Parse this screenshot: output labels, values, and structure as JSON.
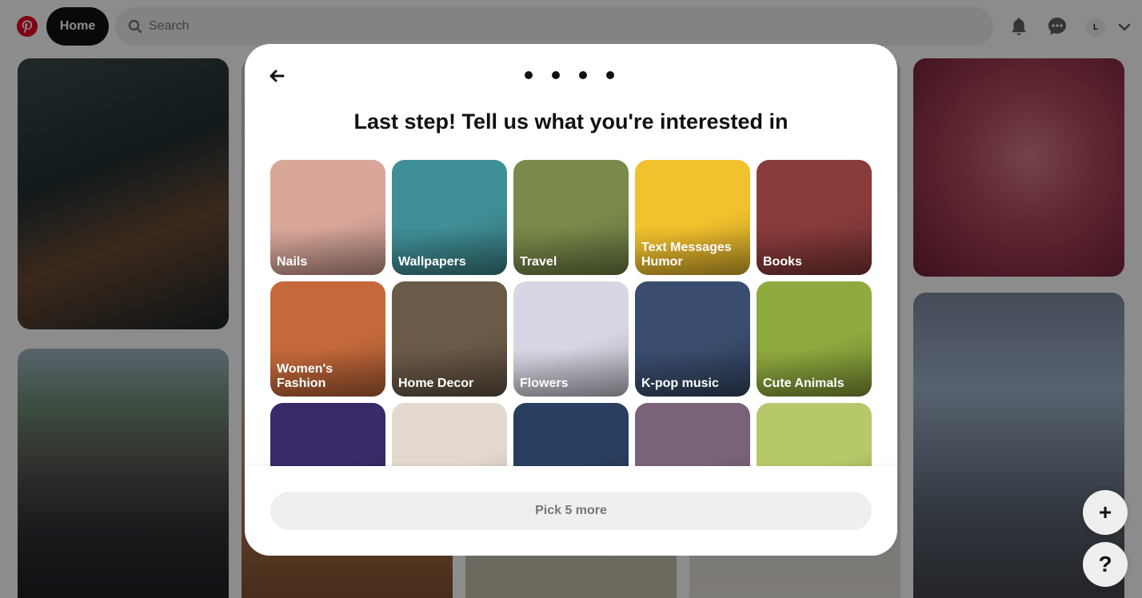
{
  "header": {
    "logo_icon": "pinterest-logo-icon",
    "home_label": "Home",
    "search_placeholder": "Search",
    "avatar_initial": "L",
    "notification_icon": "bell-icon",
    "messages_icon": "chat-icon",
    "accounts_icon": "chevron-down-icon"
  },
  "modal": {
    "back_icon": "arrow-left-icon",
    "progress_dots": 4,
    "title": "Last step! Tell us what you're interested in",
    "topics": [
      {
        "label": "Nails",
        "color": "#d9a79a"
      },
      {
        "label": "Wallpapers",
        "color": "#3f8f96"
      },
      {
        "label": "Travel",
        "color": "#7a8a4a"
      },
      {
        "label": "Text Messages Humor",
        "color": "#f2c12e"
      },
      {
        "label": "Books",
        "color": "#8a3b3b"
      },
      {
        "label": "Women's Fashion",
        "color": "#c5693a"
      },
      {
        "label": "Home Decor",
        "color": "#6b5a48"
      },
      {
        "label": "Flowers",
        "color": "#d8d6e3"
      },
      {
        "label": "K-pop music",
        "color": "#3a4d6e"
      },
      {
        "label": "Cute Animals",
        "color": "#8faa3e"
      },
      {
        "label": "",
        "color": "#3a2a6a"
      },
      {
        "label": "",
        "color": "#e3d9cf"
      },
      {
        "label": "",
        "color": "#2a3e5f"
      },
      {
        "label": "",
        "color": "#7a6378"
      },
      {
        "label": "",
        "color": "#b6c96a"
      }
    ],
    "pick_button_label": "Pick 5 more"
  },
  "fabs": {
    "create_label": "+",
    "help_label": "?"
  }
}
